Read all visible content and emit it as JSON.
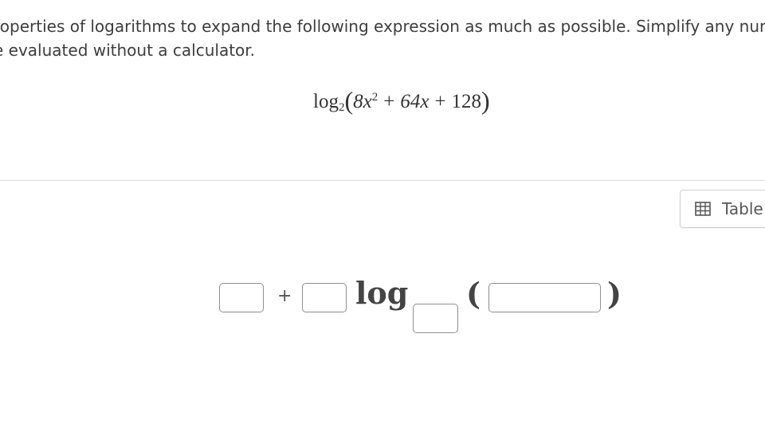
{
  "instructions": {
    "line1": "roperties of logarithms to expand the following expression as much as possible. Simplify any nume",
    "line2": "e evaluated without a calculator."
  },
  "expression": {
    "func": "log",
    "base": "2",
    "open": "(",
    "term1_coef": "8x",
    "term1_exp": "2",
    "plus1": "+",
    "term2": "64x",
    "plus2": "+",
    "term3": "128",
    "close": ")"
  },
  "toolbar": {
    "table_label": "Table",
    "table_icon": "table-grid-icon"
  },
  "answer": {
    "plus": "+",
    "log_label": "log",
    "open_paren": "(",
    "close_paren": ")",
    "box1_value": "",
    "box2_value": "",
    "base_value": "",
    "arg_value": ""
  }
}
